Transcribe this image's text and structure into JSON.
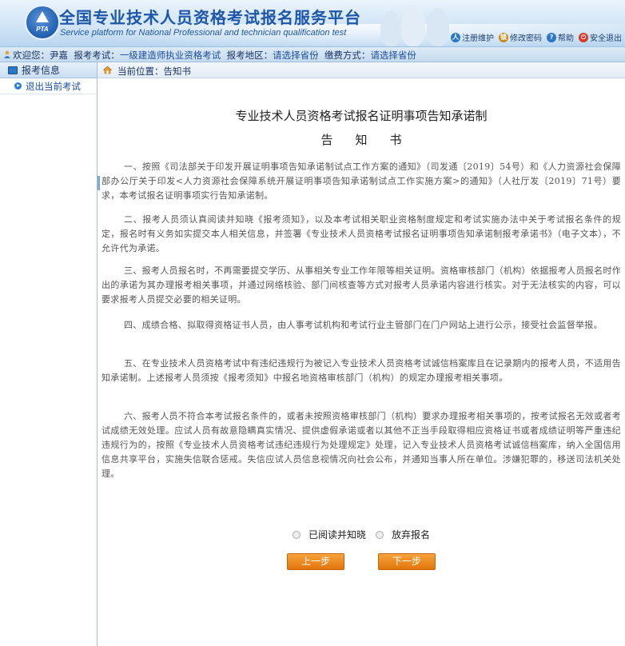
{
  "header": {
    "logo_text": "PTA",
    "title": "全国专业技术人员资格考试报名服务平台",
    "subtitle": "Service platform for National Professional and technician qualification test",
    "links": [
      {
        "label": "注册维护",
        "icon": "person-icon",
        "color": "#2b78c8"
      },
      {
        "label": "修改密码",
        "icon": "lock-icon",
        "color": "#c98a1b"
      },
      {
        "label": "帮助",
        "icon": "help-icon",
        "color": "#2b78c8"
      },
      {
        "label": "安全退出",
        "icon": "power-icon",
        "color": "#d63a2a"
      }
    ]
  },
  "infobar": {
    "welcome_label": "欢迎您：",
    "user_name": "尹嘉",
    "exam_label": "报考考试：",
    "exam_value": "一级建造师执业资格考试",
    "region_label": "报考地区：",
    "region_value": "请选择省份",
    "pay_label": "缴费方式：",
    "pay_value": "请选择省份"
  },
  "sidebar": {
    "header": "报考信息",
    "items": [
      {
        "label": "退出当前考试"
      }
    ]
  },
  "breadcrumb": {
    "text": "当前位置：告知书"
  },
  "document": {
    "title": "专业技术人员资格考试报名证明事项告知承诺制",
    "subtitle": "告知书",
    "paragraphs": [
      "一、按照《司法部关于印发开展证明事项告知承诺制试点工作方案的通知》（司发通〔2019〕54号）和《人力资源社会保障部办公厅关于印发<人力资源社会保障系统开展证明事项告知承诺制试点工作实施方案>的通知》（人社厅发〔2019〕71号）要求，本考试报名证明事项实行告知承诺制。",
      "二、报考人员须认真阅读并知晓《报考须知》，以及本考试相关职业资格制度规定和考试实施办法中关于考试报名条件的规定，报名时有义务如实提交本人相关信息，并签署《专业技术人员资格考试报名证明事项告知承诺制报考承诺书》（电子文本），不允许代为承诺。",
      "三、报考人员报名时，不再需要提交学历、从事相关专业工作年限等相关证明。资格审核部门（机构）依据报考人员报名时作出的承诺为其办理报考相关事项，并通过网络核验、部门间核查等方式对报考人员承诺内容进行核实。对于无法核实的内容，可以要求报考人员提交必要的相关证明。",
      "四、成绩合格、拟取得资格证书人员，由人事考试机构和考试行业主管部门在门户网站上进行公示，接受社会监督举报。",
      "五、在专业技术人员资格考试中有违纪违规行为被记入专业技术人员资格考试诚信档案库且在记录期内的报考人员，不适用告知承诺制。上述报考人员须按《报考须知》中报名地资格审核部门（机构）的规定办理报考相关事项。",
      "六、报考人员不符合本考试报名条件的，或者未按照资格审核部门（机构）要求办理报考相关事项的，按考试报名无效或者考试成绩无效处理。应试人员有故意隐瞒真实情况、提供虚假承诺或者以其他不正当手段取得相应资格证书或者成绩证明等严重违纪违规行为的，按照《专业技术人员资格考试违纪违规行为处理规定》处理，记入专业技术人员资格考试诚信档案库，纳入全国信用信息共享平台，实施失信联合惩戒。失信应试人员信息视情况向社会公布，并通知当事人所在单位。涉嫌犯罪的，移送司法机关处理。"
    ]
  },
  "options": {
    "agree_label": "已阅读并知晓",
    "abandon_label": "放弃报名"
  },
  "buttons": {
    "prev_label": "上一步",
    "next_label": "下一步"
  }
}
